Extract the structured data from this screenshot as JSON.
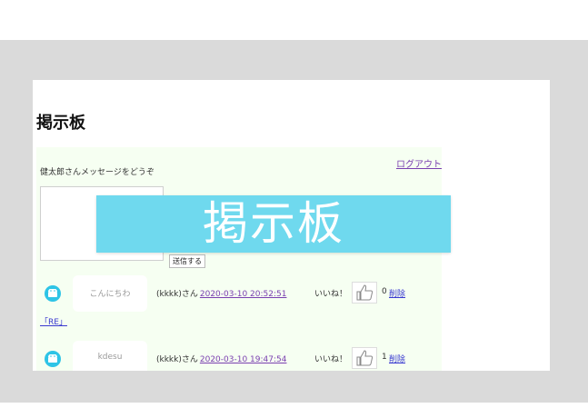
{
  "page": {
    "title": "掲示板"
  },
  "header": {
    "logout_label": "ログアウト",
    "welcome_text": "健太郎さんメッセージをどうぞ"
  },
  "form": {
    "textarea_value": "",
    "send_label": "送信する"
  },
  "reply_link_label": "「RE」",
  "overlay": {
    "text": "掲示板"
  },
  "posts": [
    {
      "message": "こんにちわ",
      "author": "(kkkk)さん",
      "date": "2020-03-10 20:52:51",
      "like_label": "いいね！",
      "like_count": "0",
      "delete_label": "削除"
    },
    {
      "message": "kdesu",
      "author": "(kkkk)さん",
      "date": "2020-03-10 19:47:54",
      "like_label": "いいね！",
      "like_count": "1",
      "delete_label": "削除"
    }
  ],
  "colors": {
    "outer_background": "#dadada",
    "board_background": "#f6fff2",
    "avatar": "#2ec4e6",
    "overlay": "#6fd9ee",
    "link_visited": "#7a3fb0",
    "link": "#3a3ad0"
  },
  "icons": {
    "avatar": "android-robot-icon",
    "like": "thumbs-up-icon"
  }
}
